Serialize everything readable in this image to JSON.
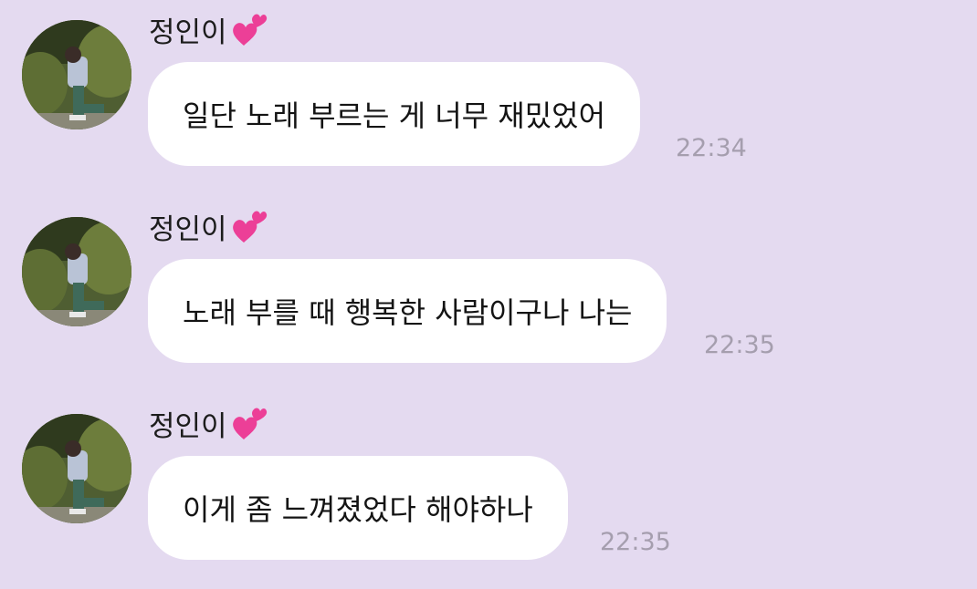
{
  "colors": {
    "background": "#e4daf0",
    "bubble": "#ffffff",
    "timestamp": "#a59eae",
    "heart": "#ec3f97"
  },
  "messages": [
    {
      "sender": "정인이",
      "sender_icon": "two-hearts-icon",
      "text": "일단 노래 부르는 게 너무 재밌었어",
      "time": "22:34"
    },
    {
      "sender": "정인이",
      "sender_icon": "two-hearts-icon",
      "text": "노래 부를 때 행복한 사람이구나 나는",
      "time": "22:35"
    },
    {
      "sender": "정인이",
      "sender_icon": "two-hearts-icon",
      "text": "이게 좀 느껴졌었다 해야하나",
      "time": "22:35"
    }
  ]
}
